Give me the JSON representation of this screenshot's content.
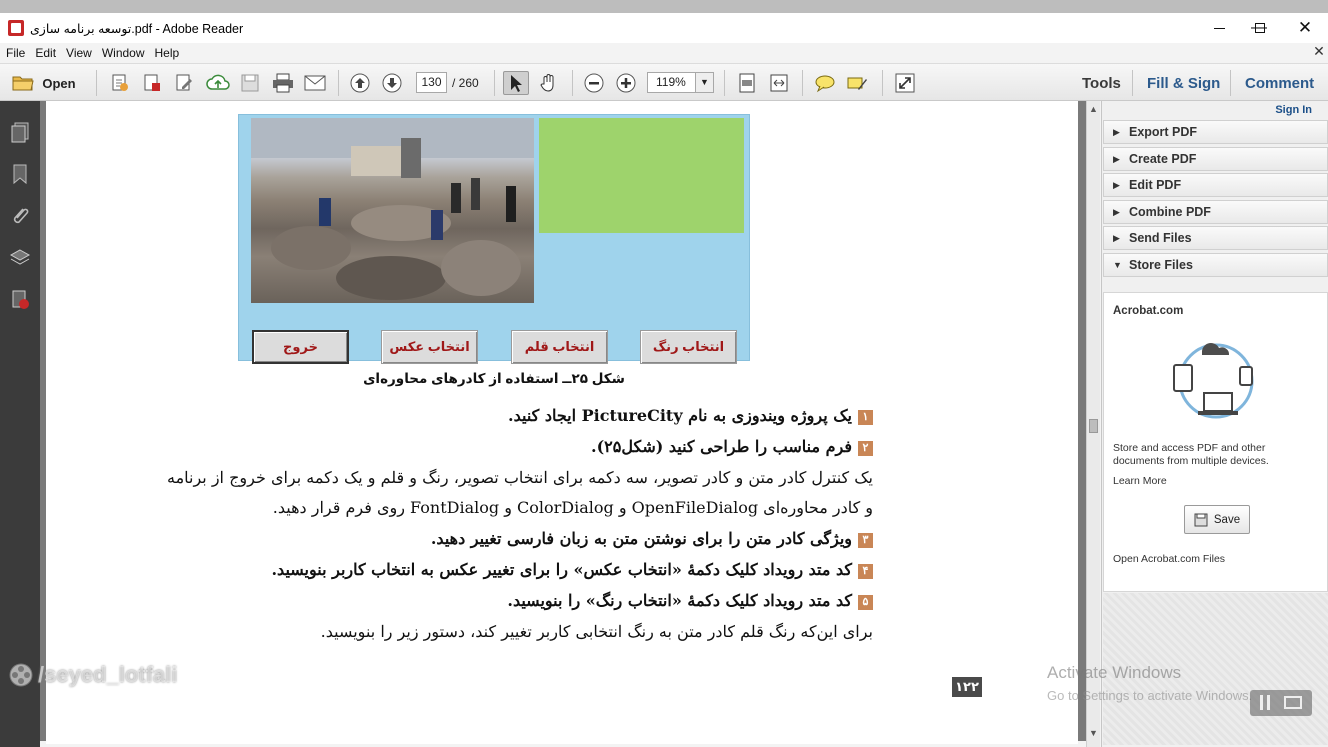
{
  "window": {
    "title": "توسعه برنامه سازی.pdf - Adobe Reader"
  },
  "menu": [
    "File",
    "Edit",
    "View",
    "Window",
    "Help"
  ],
  "toolbar": {
    "open_label": "Open",
    "current_page": "130",
    "total_pages": "/ 260",
    "zoom": "119%",
    "tools_label": "Tools",
    "fill_sign_label": "Fill & Sign",
    "comment_label": "Comment"
  },
  "right_pane": {
    "sign_in": "Sign In",
    "panels": [
      {
        "label": "Export PDF",
        "expanded": false
      },
      {
        "label": "Create PDF",
        "expanded": false
      },
      {
        "label": "Edit PDF",
        "expanded": false
      },
      {
        "label": "Combine PDF",
        "expanded": false
      },
      {
        "label": "Send Files",
        "expanded": false
      },
      {
        "label": "Store Files",
        "expanded": true
      }
    ],
    "store": {
      "heading": "Acrobat.com",
      "description_line1": "Store and access PDF and other",
      "description_line2": "documents from multiple devices.",
      "learn_more": "Learn More",
      "save_button": "Save",
      "open_files": "Open Acrobat.com Files"
    }
  },
  "document": {
    "figure_buttons": [
      "انتخاب رنگ",
      "انتخاب قلم",
      "انتخاب عکس",
      "خروج"
    ],
    "caption": "شکل ۲۵ــ استفاده از کادرهای محاوره‌ای",
    "steps": [
      {
        "num": "۱",
        "text": "یک پروژه ویندوزی به نام PictureCity ایجاد کنید."
      },
      {
        "num": "۲",
        "text": "فرم مناسب را طراحی کنید (شکل۲۵)."
      },
      {
        "num": "۳",
        "text": "ویژگی کادر متن را برای نوشتن متن به زبان فارسی تغییر دهید."
      },
      {
        "num": "۴",
        "text": "کد متد رویداد کلیک دکمهٔ «انتخاب عکس» را برای تغییر عکس به انتخاب کاربر بنویسید."
      },
      {
        "num": "۵",
        "text": "کد متد رویداد کلیک دکمهٔ «انتخاب رنگ» را بنویسید."
      }
    ],
    "para1_line1": "یک کنترل کادر متن و کادر تصویر، سه دکمه برای انتخاب تصویر، رنگ و قلم و یک دکمه برای خروج از برنامه",
    "para1_line2": "و کادر محاوره‌ای  OpenFileDialog  و  ColorDialog  و  FontDialog روی فرم قرار دهید.",
    "para2": "برای این‌که رنگ قلم کادر متن به رنگ انتخابی کاربر تغییر کند، دستور زیر را بنویسید.",
    "page_number": "۱۲۲"
  },
  "overlays": {
    "watermark": "/seyed_lotfali",
    "activate_title": "Activate Windows",
    "activate_sub": "Go to Settings to activate Windows."
  }
}
